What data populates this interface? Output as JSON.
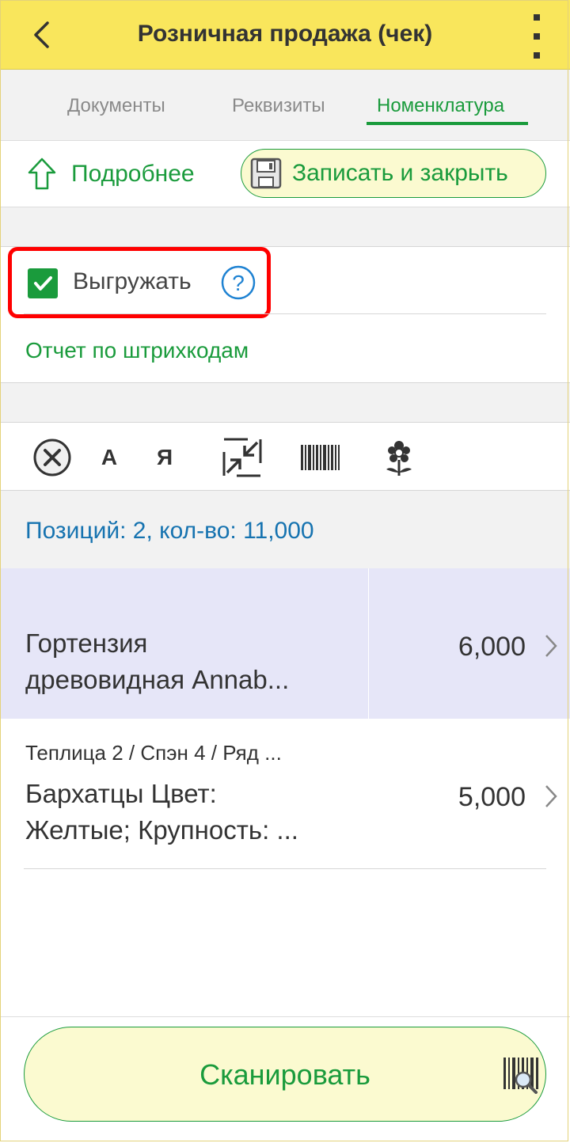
{
  "header": {
    "title": "Розничная продажа (чек)",
    "back_icon": "arrow-left-icon",
    "menu_icon": "kebab-menu-icon"
  },
  "tabs": [
    {
      "label": "Документы",
      "active": false
    },
    {
      "label": "Реквизиты",
      "active": false
    },
    {
      "label": "Номенклатура",
      "active": true
    }
  ],
  "toolbar": {
    "more_label": "Подробнее",
    "save_close_label": "Записать и закрыть"
  },
  "upload": {
    "label": "Выгружать",
    "checked": true
  },
  "report_link": "Отчет по штрихкодам",
  "icon_toolbar": {
    "sort_asc_label": "А",
    "sort_desc_label": "Я"
  },
  "summary": "Позиций: 2, кол-во: 11,000",
  "items": [
    {
      "name_line1": "Гортензия",
      "name_line2": "древовидная Annab...",
      "qty": "6,000",
      "selected": true
    },
    {
      "location": "Теплица 2 / Спэн 4 / Ряд ...",
      "name_line1": "Бархатцы Цвет:",
      "name_line2": "Желтые; Крупность: ...",
      "qty": "5,000",
      "selected": false
    }
  ],
  "scan_button": {
    "label": "Сканировать"
  },
  "colors": {
    "header_bg": "#f9e65c",
    "accent_green": "#1a9b3c",
    "summary_blue": "#1673b0",
    "selected_row": "#e6e6f8",
    "highlight_red": "#ff0000"
  }
}
